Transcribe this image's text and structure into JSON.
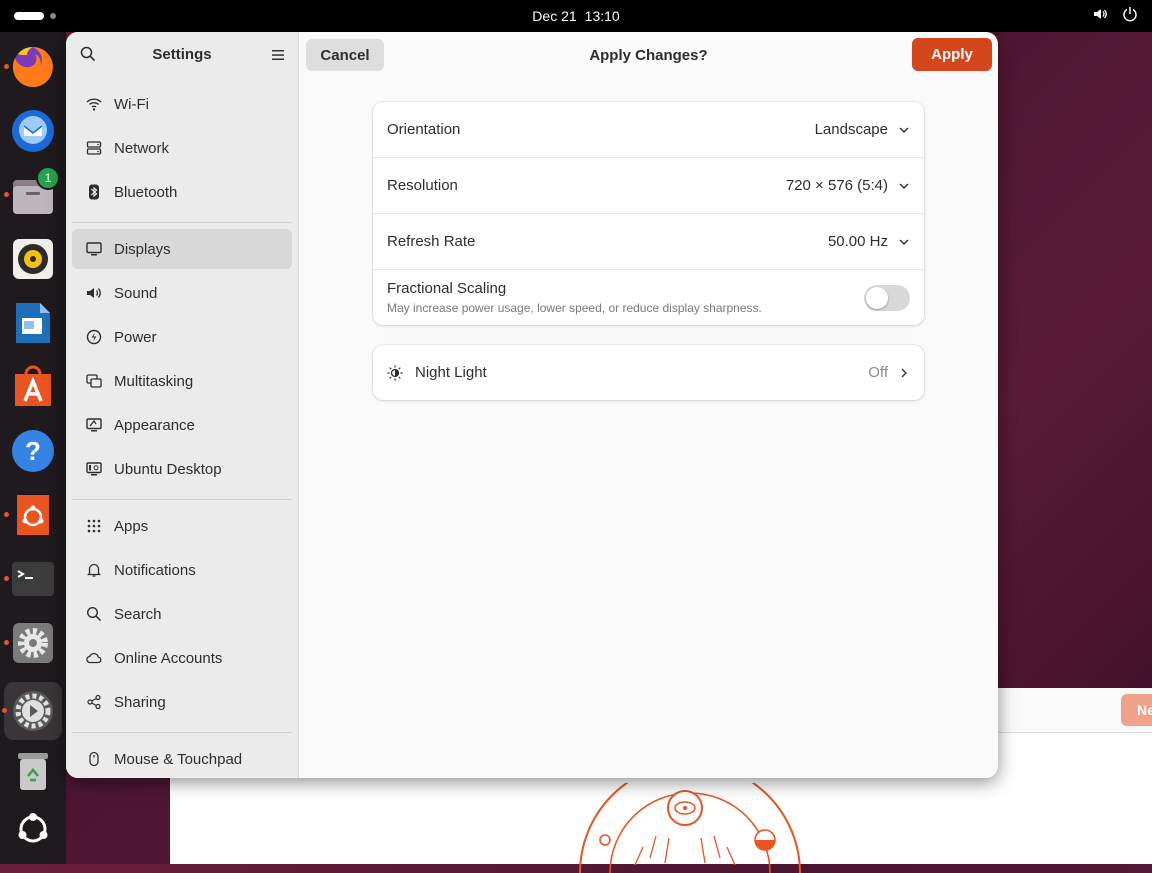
{
  "topbar": {
    "date": "Dec 21",
    "time": "13:10"
  },
  "dock": {
    "items": [
      {
        "name": "firefox-icon"
      },
      {
        "name": "thunderbird-icon"
      },
      {
        "name": "files-icon",
        "badge": "1"
      },
      {
        "name": "rhythmbox-icon"
      },
      {
        "name": "libreoffice-writer-icon"
      },
      {
        "name": "app-center-icon"
      },
      {
        "name": "help-icon"
      },
      {
        "name": "ubuntu-installer-icon"
      },
      {
        "name": "terminal-icon"
      },
      {
        "name": "settings-icon"
      },
      {
        "name": "settings-active-icon"
      },
      {
        "name": "trash-icon"
      },
      {
        "name": "show-apps-icon"
      }
    ]
  },
  "sidebar": {
    "title": "Settings",
    "items": [
      {
        "label": "Wi-Fi",
        "icon": "wifi-icon"
      },
      {
        "label": "Network",
        "icon": "network-icon"
      },
      {
        "label": "Bluetooth",
        "icon": "bluetooth-icon"
      },
      {
        "label": "Displays",
        "icon": "display-icon"
      },
      {
        "label": "Sound",
        "icon": "sound-icon"
      },
      {
        "label": "Power",
        "icon": "power-icon"
      },
      {
        "label": "Multitasking",
        "icon": "multitasking-icon"
      },
      {
        "label": "Appearance",
        "icon": "appearance-icon"
      },
      {
        "label": "Ubuntu Desktop",
        "icon": "ubuntu-desktop-icon"
      },
      {
        "label": "Apps",
        "icon": "apps-icon"
      },
      {
        "label": "Notifications",
        "icon": "notifications-icon"
      },
      {
        "label": "Search",
        "icon": "search-icon"
      },
      {
        "label": "Online Accounts",
        "icon": "cloud-icon"
      },
      {
        "label": "Sharing",
        "icon": "share-icon"
      },
      {
        "label": "Mouse & Touchpad",
        "icon": "mouse-icon"
      }
    ],
    "selected": "Displays"
  },
  "header": {
    "cancel_label": "Cancel",
    "title": "Apply Changes?",
    "apply_label": "Apply"
  },
  "display_settings": {
    "orientation": {
      "label": "Orientation",
      "value": "Landscape"
    },
    "resolution": {
      "label": "Resolution",
      "value": "720 × 576 (5:4)"
    },
    "refresh_rate": {
      "label": "Refresh Rate",
      "value": "50.00 Hz"
    },
    "fractional_scaling": {
      "label": "Fractional Scaling",
      "subtitle": "May increase power usage, lower speed, or reduce display sharpness.",
      "enabled": false
    }
  },
  "night_light": {
    "label": "Night Light",
    "value": "Off"
  },
  "background_window": {
    "button_label": "Ne"
  },
  "colors": {
    "accent": "#d4461c",
    "selected_bg": "#d8d8d8"
  }
}
